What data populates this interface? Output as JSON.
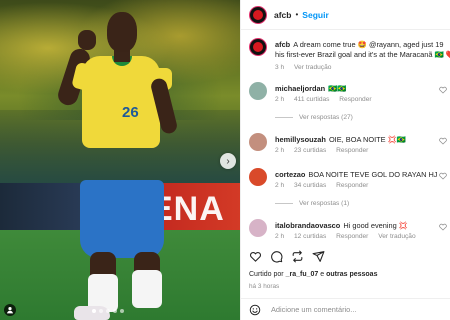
{
  "post": {
    "author": "afcb",
    "follow_label": "Seguir",
    "caption_user": "afcb",
    "caption_text": "A dream come true 🤩 @rayann, aged just 19",
    "caption_line2": "his first-ever Brazil goal and it's at the Maracanã 🇧🇷 ❤️",
    "caption_time": "3 h",
    "caption_translate": "Ver tradução",
    "jersey_number": "26",
    "ad_text": "ENA"
  },
  "comments": [
    {
      "user": "michaeljordan",
      "text": "🇧🇷🇧🇷",
      "time": "2 h",
      "likes": "411 curtidas",
      "reply": "Responder",
      "avatar_color": "#8fb1a6"
    },
    {
      "user": "hemillysouzah",
      "text": "OIE, BOA NOITE 💢🇧🇷",
      "time": "2 h",
      "likes": "23 curtidas",
      "reply": "Responder",
      "avatar_color": "#c38f7e"
    },
    {
      "user": "cortezao",
      "text": "BOA NOITE TEVE GOL DO RAYAN HJ",
      "time": "2 h",
      "likes": "34 curtidas",
      "reply": "Responder",
      "avatar_color": "#d94a2a"
    },
    {
      "user": "italobrandaovasco",
      "text": "Hi good evening 💢",
      "time": "2 h",
      "likes": "12 curtidas",
      "reply": "Responder",
      "translate": "Ver tradução",
      "avatar_color": "#d7b3c7"
    }
  ],
  "view_replies": [
    {
      "label": "Ver respostas (27)"
    },
    {
      "label": "Ver respostas (1)"
    }
  ],
  "likes_line": {
    "prefix": "Curtido por",
    "user": "_ra_fu_07",
    "connector": "e",
    "others": "outras pessoas"
  },
  "post_time": "há 3 horas",
  "comment_input": {
    "placeholder": "Adicione um comentário..."
  },
  "colors": {
    "accent": "#0095f6",
    "like_red": "#ed4956",
    "muted": "#8e8e8e"
  },
  "icons": [
    "heart-icon",
    "comment-icon",
    "repost-icon",
    "share-icon",
    "emoji-icon",
    "chevron-right-icon",
    "user-tag-icon"
  ]
}
